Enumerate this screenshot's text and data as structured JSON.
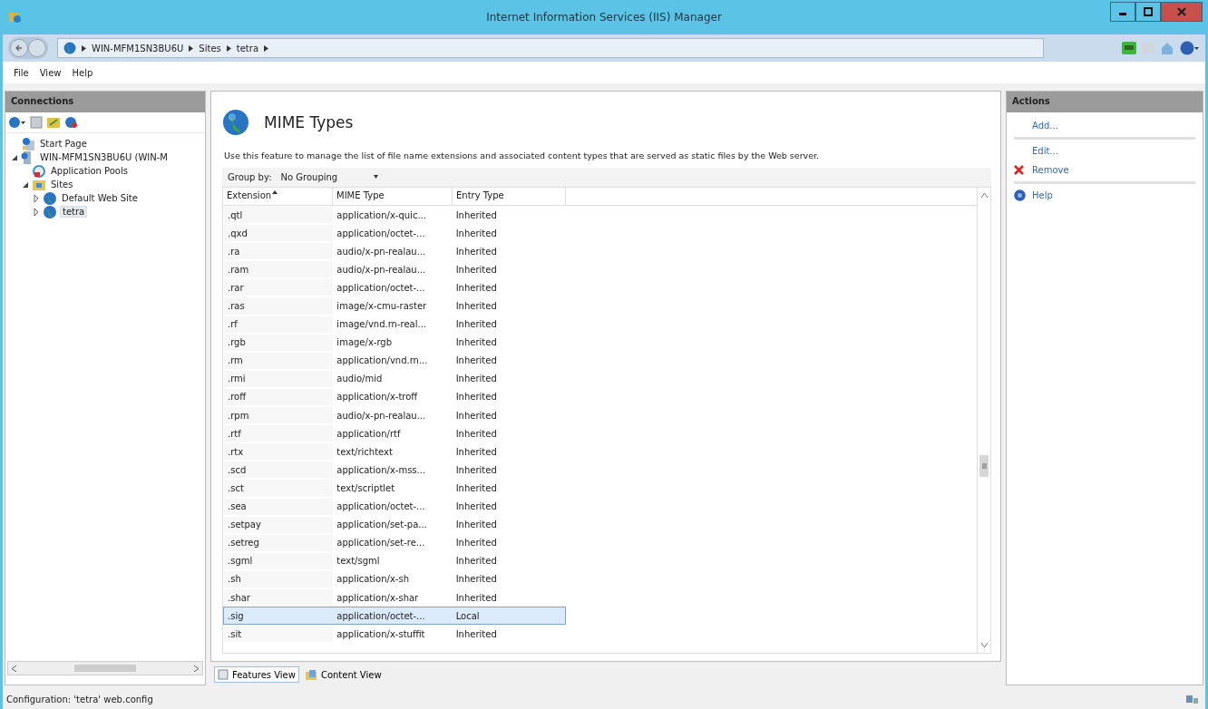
{
  "window": {
    "title": "Internet Information Services (IIS) Manager"
  },
  "breadcrumb": [
    "WIN-MFM1SN3BU6U",
    "Sites",
    "tetra"
  ],
  "menu": [
    "File",
    "View",
    "Help"
  ],
  "connections": {
    "title": "Connections",
    "tree": [
      {
        "label": "Start Page",
        "kind": "start",
        "selected": false
      },
      {
        "label": "WIN-MFM1SN3BU6U (WIN-M",
        "kind": "server",
        "expanded": true,
        "selected": false,
        "children": [
          {
            "label": "Application Pools",
            "kind": "pools",
            "selected": false
          },
          {
            "label": "Sites",
            "kind": "folder",
            "expanded": true,
            "selected": false,
            "children": [
              {
                "label": "Default Web Site",
                "kind": "site",
                "expanded": false,
                "selected": false
              },
              {
                "label": "tetra",
                "kind": "site",
                "expanded": false,
                "selected": true
              }
            ]
          }
        ]
      }
    ]
  },
  "feature": {
    "title": "MIME Types",
    "description": "Use this feature to manage the list of file name extensions and associated content types that are served as static files by the Web server.",
    "group_by_label": "Group by:",
    "group_by_value": "No Grouping"
  },
  "table": {
    "columns": [
      "Extension",
      "MIME Type",
      "Entry Type"
    ],
    "rows": [
      {
        "cells": [
          ".qtl",
          "application/x-quic...",
          "Inherited"
        ],
        "selected": false
      },
      {
        "cells": [
          ".qxd",
          "application/octet-...",
          "Inherited"
        ],
        "selected": false
      },
      {
        "cells": [
          ".ra",
          "audio/x-pn-realau...",
          "Inherited"
        ],
        "selected": false
      },
      {
        "cells": [
          ".ram",
          "audio/x-pn-realau...",
          "Inherited"
        ],
        "selected": false
      },
      {
        "cells": [
          ".rar",
          "application/octet-...",
          "Inherited"
        ],
        "selected": false
      },
      {
        "cells": [
          ".ras",
          "image/x-cmu-raster",
          "Inherited"
        ],
        "selected": false
      },
      {
        "cells": [
          ".rf",
          "image/vnd.rn-real...",
          "Inherited"
        ],
        "selected": false
      },
      {
        "cells": [
          ".rgb",
          "image/x-rgb",
          "Inherited"
        ],
        "selected": false
      },
      {
        "cells": [
          ".rm",
          "application/vnd.rn...",
          "Inherited"
        ],
        "selected": false
      },
      {
        "cells": [
          ".rmi",
          "audio/mid",
          "Inherited"
        ],
        "selected": false
      },
      {
        "cells": [
          ".roff",
          "application/x-troff",
          "Inherited"
        ],
        "selected": false
      },
      {
        "cells": [
          ".rpm",
          "audio/x-pn-realau...",
          "Inherited"
        ],
        "selected": false
      },
      {
        "cells": [
          ".rtf",
          "application/rtf",
          "Inherited"
        ],
        "selected": false
      },
      {
        "cells": [
          ".rtx",
          "text/richtext",
          "Inherited"
        ],
        "selected": false
      },
      {
        "cells": [
          ".scd",
          "application/x-mss...",
          "Inherited"
        ],
        "selected": false
      },
      {
        "cells": [
          ".sct",
          "text/scriptlet",
          "Inherited"
        ],
        "selected": false
      },
      {
        "cells": [
          ".sea",
          "application/octet-...",
          "Inherited"
        ],
        "selected": false
      },
      {
        "cells": [
          ".setpay",
          "application/set-pa...",
          "Inherited"
        ],
        "selected": false
      },
      {
        "cells": [
          ".setreg",
          "application/set-re...",
          "Inherited"
        ],
        "selected": false
      },
      {
        "cells": [
          ".sgml",
          "text/sgml",
          "Inherited"
        ],
        "selected": false
      },
      {
        "cells": [
          ".sh",
          "application/x-sh",
          "Inherited"
        ],
        "selected": false
      },
      {
        "cells": [
          ".shar",
          "application/x-shar",
          "Inherited"
        ],
        "selected": false
      },
      {
        "cells": [
          ".sig",
          "application/octet-...",
          "Local"
        ],
        "selected": true
      },
      {
        "cells": [
          ".sit",
          "application/x-stuffit",
          "Inherited"
        ],
        "selected": false
      }
    ]
  },
  "views": [
    {
      "label": "Features View",
      "selected": true
    },
    {
      "label": "Content View",
      "selected": false
    }
  ],
  "actions": {
    "title": "Actions",
    "items": [
      {
        "label": "Add...",
        "kind": "plain",
        "separator_after": true
      },
      {
        "label": "Edit...",
        "kind": "plain",
        "separator_after": false
      },
      {
        "label": "Remove",
        "kind": "remove",
        "separator_after": true
      },
      {
        "label": "Help",
        "kind": "help",
        "separator_after": false
      }
    ]
  },
  "status_bar": "Configuration: 'tetra' web.config"
}
